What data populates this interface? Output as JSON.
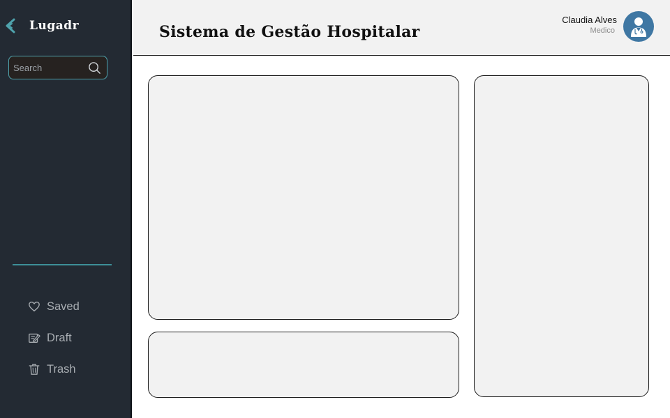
{
  "sidebar": {
    "brand_name": "Lugadr",
    "search": {
      "placeholder": "Search",
      "value": ""
    },
    "nav_items": [
      {
        "label": "Saved",
        "icon": "heart-icon"
      },
      {
        "label": "Draft",
        "icon": "draft-icon"
      },
      {
        "label": "Trash",
        "icon": "trash-icon"
      }
    ]
  },
  "header": {
    "title": "Sistema de Gestão Hospitalar",
    "user": {
      "name": "Claudia Alves",
      "role": "Medico",
      "avatar_icon": "doctor-avatar-icon"
    }
  },
  "colors": {
    "sidebar_bg": "#232a33",
    "accent": "#4fa3ad",
    "avatar_bg": "#3f77a3",
    "panel_bg": "#f2f2f2"
  }
}
